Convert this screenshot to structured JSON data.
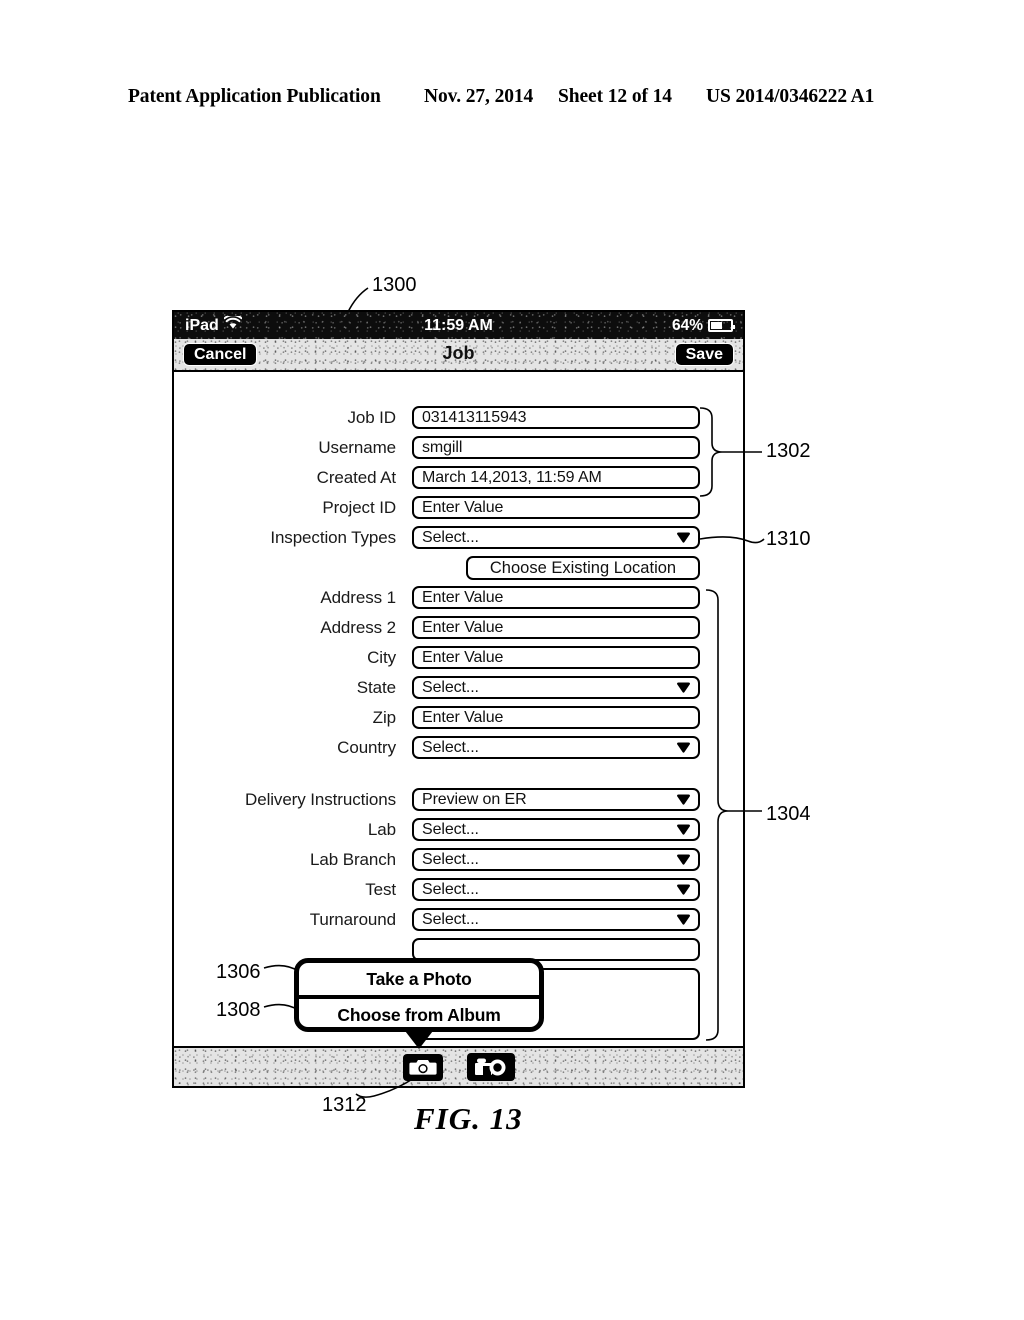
{
  "patent_header": {
    "publication": "Patent Application Publication",
    "date": "Nov. 27, 2014",
    "sheet": "Sheet 12 of 14",
    "number": "US 2014/0346222 A1"
  },
  "figure": {
    "caption": "FIG. 13",
    "reference_numerals": {
      "device": "1300",
      "readonly_group": "1302",
      "detail_group": "1304",
      "take_photo": "1306",
      "choose_album": "1308",
      "inspection_types_dropdown": "1310",
      "camera_button": "1312"
    }
  },
  "device": {
    "statusbar": {
      "carrier": "iPad",
      "wifi_icon": "wifi-icon",
      "time": "11:59 AM",
      "battery_percent": "64%",
      "battery_icon": "battery-icon"
    },
    "navbar": {
      "cancel_label": "Cancel",
      "title": "Job",
      "save_label": "Save"
    },
    "form": {
      "rows": [
        {
          "label": "Job ID",
          "value": "031413115943",
          "type": "text"
        },
        {
          "label": "Username",
          "value": "smgill",
          "type": "text"
        },
        {
          "label": "Created At",
          "value": "March 14,2013, 11:59 AM",
          "type": "text"
        },
        {
          "label": "Project ID",
          "value": "Enter Value",
          "type": "text"
        },
        {
          "label": "Inspection Types",
          "value": "Select...",
          "type": "select"
        },
        {
          "label": "Address 1",
          "value": "Enter Value",
          "type": "text"
        },
        {
          "label": "Address 2",
          "value": "Enter Value",
          "type": "text"
        },
        {
          "label": "City",
          "value": "Enter Value",
          "type": "text"
        },
        {
          "label": "State",
          "value": "Select...",
          "type": "select"
        },
        {
          "label": "Zip",
          "value": "Enter Value",
          "type": "text"
        },
        {
          "label": "Country",
          "value": "Select...",
          "type": "select"
        },
        {
          "label": "Delivery Instructions",
          "value": "Preview on ER",
          "type": "select"
        },
        {
          "label": "Lab",
          "value": "Select...",
          "type": "select"
        },
        {
          "label": "Lab Branch",
          "value": "Select...",
          "type": "select"
        },
        {
          "label": "Test",
          "value": "Select...",
          "type": "select"
        },
        {
          "label": "Turnaround",
          "value": "Select...",
          "type": "select"
        }
      ],
      "choose_location_label": "Choose Existing Location"
    },
    "popover": {
      "take_photo_label": "Take a Photo",
      "choose_album_label": "Choose from Album"
    },
    "toolbar": {
      "photo_icon": "camera-icon",
      "video_icon": "video-camera-icon"
    }
  }
}
